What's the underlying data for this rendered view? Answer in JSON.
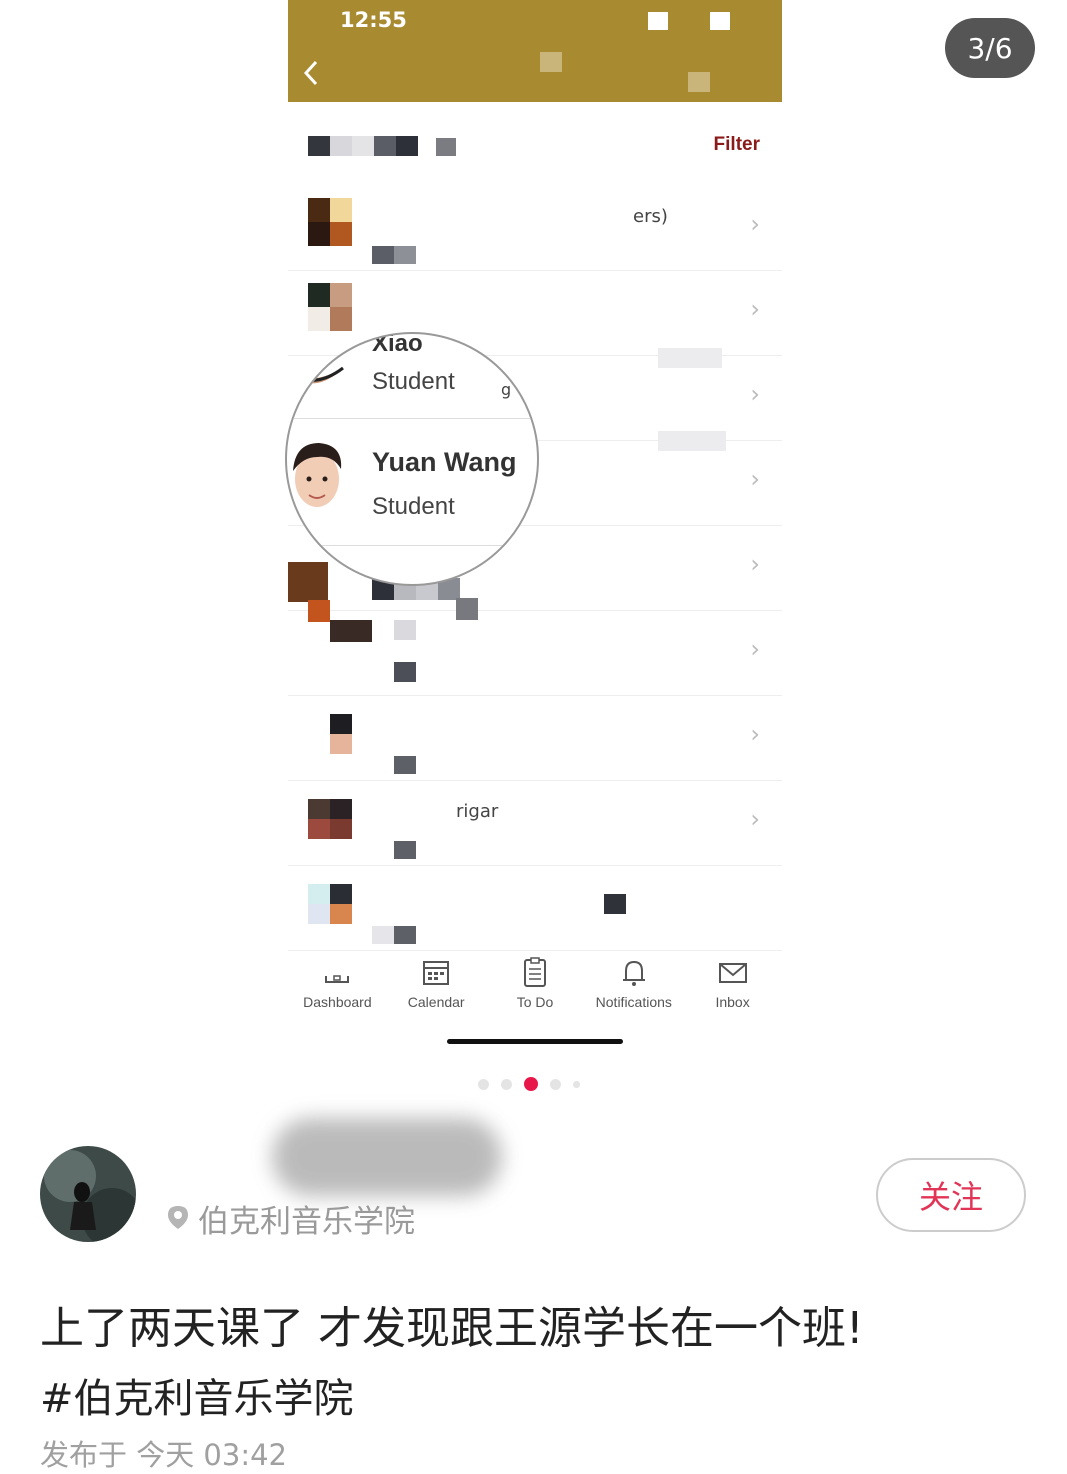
{
  "page_counter": "3/6",
  "phone": {
    "status_time": "12:55",
    "filter_label": "Filter",
    "rows": [
      {
        "extra": "ers)"
      },
      {
        "extra": ""
      },
      {
        "extra": "g"
      },
      {
        "extra": ""
      },
      {
        "extra": ""
      },
      {
        "extra": ""
      },
      {
        "extra": ""
      },
      {
        "extra": "rigar"
      },
      {
        "extra": ""
      }
    ],
    "magnifier": {
      "prev_name": "Xiao",
      "prev_role": "Student",
      "prev_extra": "g",
      "name": "Yuan Wang",
      "role": "Student"
    },
    "tabs": [
      {
        "label": "Dashboard",
        "icon": "dashboard-icon"
      },
      {
        "label": "Calendar",
        "icon": "calendar-icon"
      },
      {
        "label": "To Do",
        "icon": "todo-icon"
      },
      {
        "label": "Notifications",
        "icon": "bell-icon"
      },
      {
        "label": "Inbox",
        "icon": "mail-icon"
      }
    ]
  },
  "carousel": {
    "current": 3,
    "total": 5
  },
  "post": {
    "location": "伯克利音乐学院",
    "follow_label": "关注",
    "title": "上了两天课了 才发现跟王源学长在一个班!",
    "tag": "#伯克利音乐学院",
    "time": "发布于 今天 03:42"
  },
  "colors": {
    "status_bar": "#a88a30",
    "filter": "#8b1a1a",
    "accent": "#e23456"
  }
}
